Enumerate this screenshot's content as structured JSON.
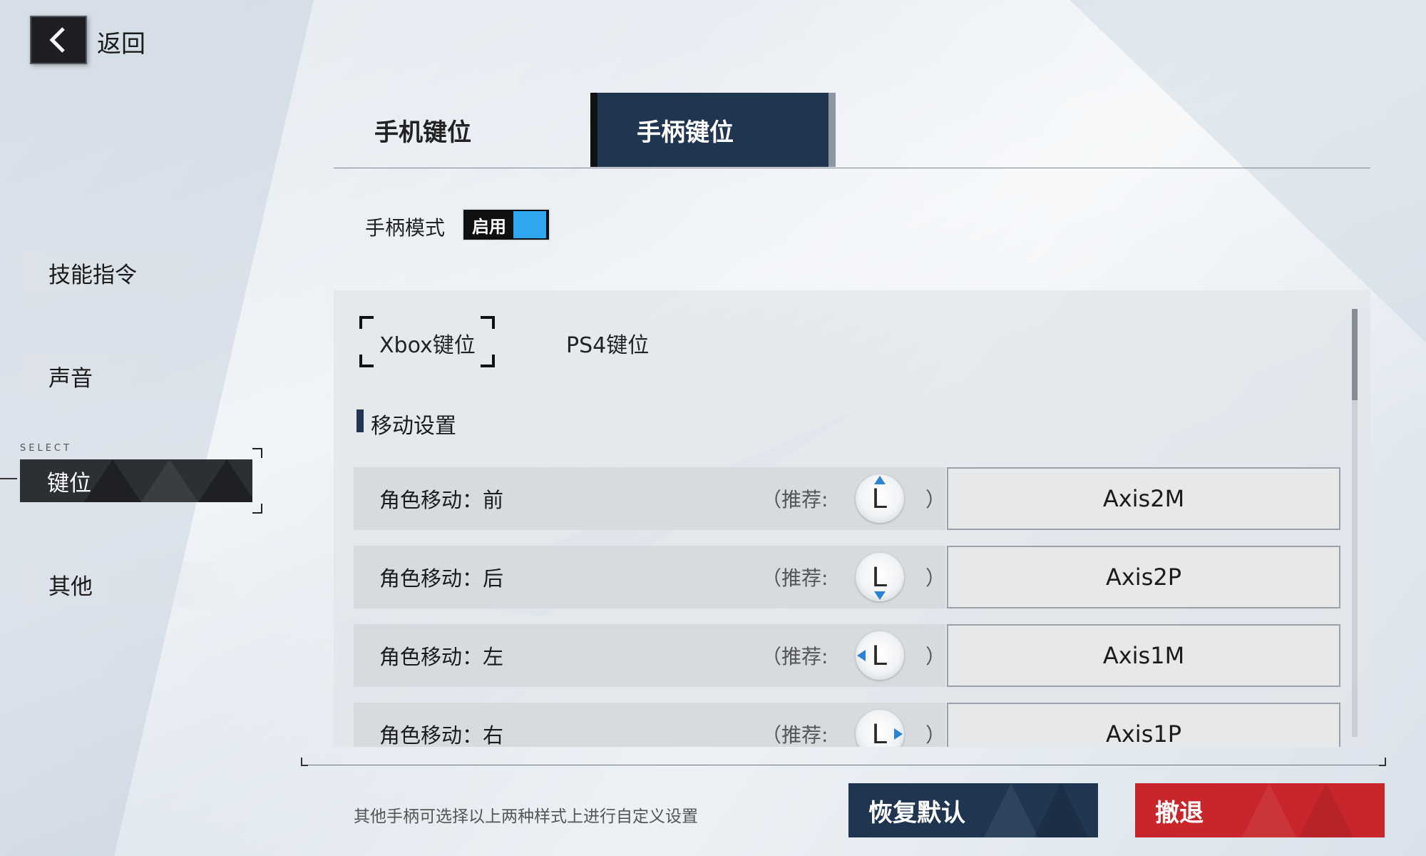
{
  "back": {
    "label": "返回",
    "icon": "chevron-left-icon"
  },
  "sidebar": {
    "select_tag": "SELECT",
    "items": [
      {
        "label": "技能指令"
      },
      {
        "label": "声音"
      },
      {
        "label": "键位"
      },
      {
        "label": "其他"
      }
    ],
    "active_index": 2
  },
  "tabs": {
    "phone": "手机键位",
    "controller": "手柄键位",
    "active": "controller"
  },
  "controller_mode": {
    "label": "手柄模式",
    "state": "启用",
    "enabled": true,
    "accent": "#2fa7f1"
  },
  "panel": {
    "subtabs": {
      "xbox": "Xbox键位",
      "ps4": "PS4键位",
      "active": "xbox"
    },
    "section_title": "移动设置",
    "recommend_label": "（推荐:",
    "recommend_close": "）",
    "rows": [
      {
        "label": "角色移动：前",
        "stick": "L",
        "direction": "up",
        "key": "Axis2M"
      },
      {
        "label": "角色移动：后",
        "stick": "L",
        "direction": "down",
        "key": "Axis2P"
      },
      {
        "label": "角色移动：左",
        "stick": "L",
        "direction": "left",
        "key": "Axis1M"
      },
      {
        "label": "角色移动：右",
        "stick": "L",
        "direction": "right",
        "key": "Axis1P"
      }
    ]
  },
  "footer": {
    "hint": "其他手柄可选择以上两种样式上进行自定义设置",
    "reset_button": "恢复默认",
    "quit_button": "撤退",
    "colors": {
      "reset": "#1f3550",
      "quit": "#c8262b"
    }
  }
}
